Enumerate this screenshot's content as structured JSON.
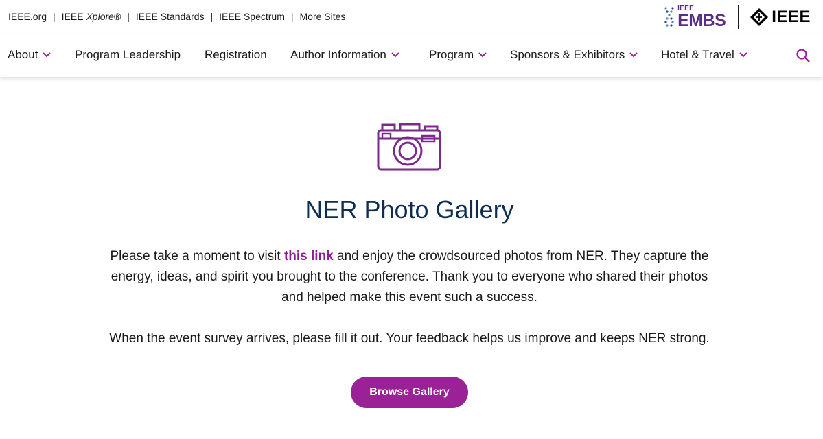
{
  "utility_bar": {
    "links": [
      {
        "label": "IEEE.org"
      },
      {
        "prefix": "IEEE ",
        "italic": "Xplore",
        "suffix": "®"
      },
      {
        "label": "IEEE Standards"
      },
      {
        "label": "IEEE Spectrum"
      },
      {
        "label": "More Sites"
      }
    ],
    "separator": "|"
  },
  "logos": {
    "embs_small": "IEEE",
    "embs_main": "EMBS",
    "ieee": "IEEE"
  },
  "nav": {
    "items": [
      {
        "label": "About",
        "dropdown": true
      },
      {
        "label": "Program Leadership",
        "dropdown": false
      },
      {
        "label": "Registration",
        "dropdown": false
      },
      {
        "label": "Author Information",
        "dropdown": true
      },
      {
        "label": "Program",
        "dropdown": true
      },
      {
        "label": "Sponsors & Exhibitors",
        "dropdown": true
      },
      {
        "label": "Hotel & Travel",
        "dropdown": true
      }
    ],
    "search_icon": "search-icon"
  },
  "main": {
    "icon": "camera-icon",
    "title": "NER Photo Gallery",
    "para1_before": "Please take a moment to visit ",
    "para1_link": "this link",
    "para1_after": " and enjoy the crowdsourced photos from NER. They capture the energy, ideas, and spirit you brought to the conference. Thank you to everyone who shared their photos and helped make this event such a success.",
    "para2": "When the event survey arrives, please fill it out. Your feedback helps us improve and keeps NER strong.",
    "button_label": "Browse Gallery"
  },
  "colors": {
    "accent_purple": "#9b2196",
    "link_purple": "#8a1f91",
    "title_navy": "#0f2d52",
    "embs_purple": "#5b2d86"
  }
}
